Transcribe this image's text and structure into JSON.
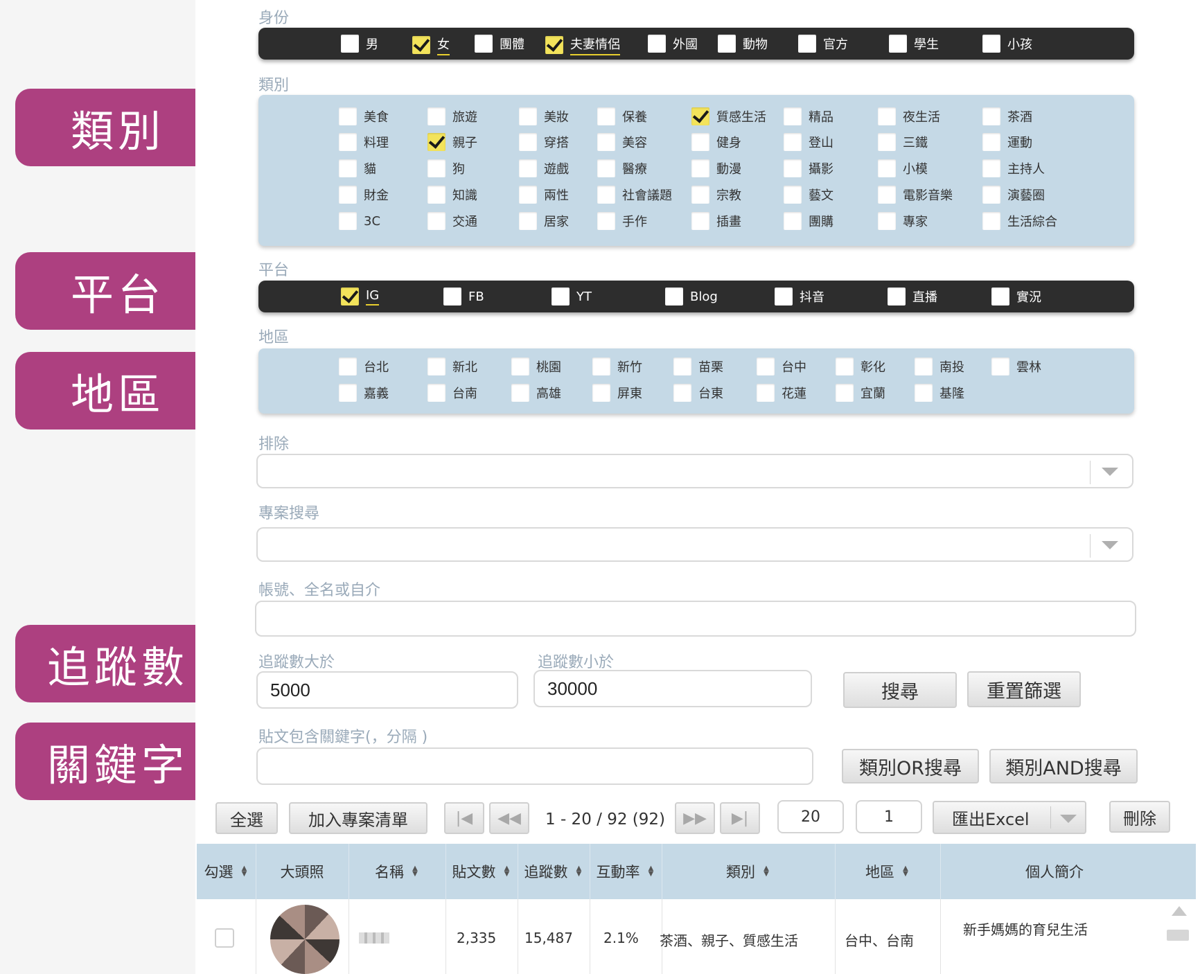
{
  "sidebar_labels": [
    "類別",
    "平台",
    "地區",
    "追蹤數",
    "關鍵字"
  ],
  "identity": {
    "label": "身份",
    "items": [
      {
        "label": "男",
        "checked": false
      },
      {
        "label": "女",
        "checked": true
      },
      {
        "label": "團體",
        "checked": false
      },
      {
        "label": "夫妻情侶",
        "checked": true
      },
      {
        "label": "外國",
        "checked": false
      },
      {
        "label": "動物",
        "checked": false
      },
      {
        "label": "官方",
        "checked": false
      },
      {
        "label": "學生",
        "checked": false
      },
      {
        "label": "小孩",
        "checked": false
      }
    ]
  },
  "category": {
    "label": "類別",
    "rows": [
      [
        {
          "label": "美食",
          "checked": false
        },
        {
          "label": "旅遊",
          "checked": false
        },
        {
          "label": "美妝",
          "checked": false
        },
        {
          "label": "保養",
          "checked": false
        },
        {
          "label": "質感生活",
          "checked": true
        },
        {
          "label": "精品",
          "checked": false
        },
        {
          "label": "夜生活",
          "checked": false
        },
        {
          "label": "茶酒",
          "checked": false
        }
      ],
      [
        {
          "label": "料理",
          "checked": false
        },
        {
          "label": "親子",
          "checked": true
        },
        {
          "label": "穿搭",
          "checked": false
        },
        {
          "label": "美容",
          "checked": false
        },
        {
          "label": "健身",
          "checked": false
        },
        {
          "label": "登山",
          "checked": false
        },
        {
          "label": "三鐵",
          "checked": false
        },
        {
          "label": "運動",
          "checked": false
        }
      ],
      [
        {
          "label": "貓",
          "checked": false
        },
        {
          "label": "狗",
          "checked": false
        },
        {
          "label": "遊戲",
          "checked": false
        },
        {
          "label": "醫療",
          "checked": false
        },
        {
          "label": "動漫",
          "checked": false
        },
        {
          "label": "攝影",
          "checked": false
        },
        {
          "label": "小模",
          "checked": false
        },
        {
          "label": "主持人",
          "checked": false
        }
      ],
      [
        {
          "label": "財金",
          "checked": false
        },
        {
          "label": "知識",
          "checked": false
        },
        {
          "label": "兩性",
          "checked": false
        },
        {
          "label": "社會議題",
          "checked": false
        },
        {
          "label": "宗教",
          "checked": false
        },
        {
          "label": "藝文",
          "checked": false
        },
        {
          "label": "電影音樂",
          "checked": false
        },
        {
          "label": "演藝圈",
          "checked": false
        }
      ],
      [
        {
          "label": "3C",
          "checked": false
        },
        {
          "label": "交通",
          "checked": false
        },
        {
          "label": "居家",
          "checked": false
        },
        {
          "label": "手作",
          "checked": false
        },
        {
          "label": "插畫",
          "checked": false
        },
        {
          "label": "團購",
          "checked": false
        },
        {
          "label": "專家",
          "checked": false
        },
        {
          "label": "生活綜合",
          "checked": false
        }
      ]
    ]
  },
  "platform": {
    "label": "平台",
    "items": [
      {
        "label": "IG",
        "checked": true
      },
      {
        "label": "FB",
        "checked": false
      },
      {
        "label": "YT",
        "checked": false
      },
      {
        "label": "Blog",
        "checked": false
      },
      {
        "label": "抖音",
        "checked": false
      },
      {
        "label": "直播",
        "checked": false
      },
      {
        "label": "實況",
        "checked": false
      }
    ]
  },
  "region": {
    "label": "地區",
    "rows": [
      [
        {
          "label": "台北",
          "checked": false
        },
        {
          "label": "新北",
          "checked": false
        },
        {
          "label": "桃園",
          "checked": false
        },
        {
          "label": "新竹",
          "checked": false
        },
        {
          "label": "苗栗",
          "checked": false
        },
        {
          "label": "台中",
          "checked": false
        },
        {
          "label": "彰化",
          "checked": false
        },
        {
          "label": "南投",
          "checked": false
        },
        {
          "label": "雲林",
          "checked": false
        }
      ],
      [
        {
          "label": "嘉義",
          "checked": false
        },
        {
          "label": "台南",
          "checked": false
        },
        {
          "label": "高雄",
          "checked": false
        },
        {
          "label": "屏東",
          "checked": false
        },
        {
          "label": "台東",
          "checked": false
        },
        {
          "label": "花蓮",
          "checked": false
        },
        {
          "label": "宜蘭",
          "checked": false
        },
        {
          "label": "基隆",
          "checked": false
        }
      ]
    ]
  },
  "exclude": {
    "label": "排除",
    "value": ""
  },
  "project_search": {
    "label": "專案搜尋",
    "value": ""
  },
  "account_search": {
    "label": "帳號、全名或自介",
    "value": ""
  },
  "followers": {
    "min_label": "追蹤數大於",
    "min_value": "5000",
    "max_label": "追蹤數小於",
    "max_value": "30000"
  },
  "keywords": {
    "label": "貼文包含關鍵字(，分隔 )",
    "value": ""
  },
  "buttons": {
    "search": "搜尋",
    "reset": "重置篩選",
    "or_search": "類別OR搜尋",
    "and_search": "類別AND搜尋",
    "select_all": "全選",
    "add_to_project": "加入專案清單",
    "export": "匯出Excel",
    "delete": "刪除"
  },
  "pager": {
    "first_icon": "first-page-icon",
    "prev_icon": "prev-page-icon",
    "next_icon": "next-page-icon",
    "last_icon": "last-page-icon",
    "range": "1 - 20 / 92 (92)",
    "page_size": "20",
    "page_number": "1"
  },
  "table": {
    "headers": [
      "勾選",
      "大頭照",
      "名稱",
      "貼文數",
      "追蹤數",
      "互動率",
      "類別",
      "地區",
      "個人簡介"
    ],
    "rows": [
      {
        "checked": false,
        "name": "",
        "posts": "2,335",
        "followers": "15,487",
        "engagement": "2.1%",
        "categories": "茶酒、親子、質感生活",
        "regions": "台中、台南",
        "bio": "新手媽媽的育兒生活"
      }
    ]
  },
  "colors": {
    "accent": "#ad4080",
    "dark_bar": "#2d2d2d",
    "light_panel": "#c5d9e6",
    "check": "#f3e35b"
  }
}
